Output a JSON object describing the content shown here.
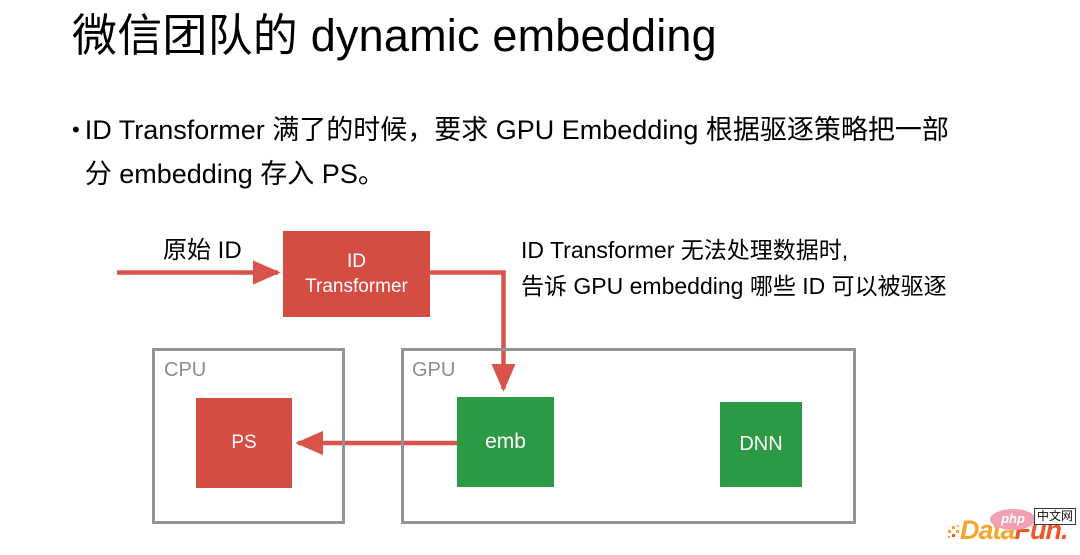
{
  "slide": {
    "title": "微信团队的 dynamic embedding",
    "bullet": {
      "marker": "•",
      "text": "ID Transformer 满了的时候，要求 GPU Embedding 根据驱逐策略把一部分 embedding 存入 PS。"
    }
  },
  "diagram": {
    "input_label": "原始 ID",
    "annotation_line1": "ID Transformer 无法处理数据时,",
    "annotation_line2": "告诉 GPU embedding 哪些 ID 可以被驱逐",
    "boxes": {
      "id_transformer_line1": "ID",
      "id_transformer_line2": "Transformer",
      "ps": "PS",
      "emb": "emb",
      "dnn": "DNN"
    },
    "containers": {
      "cpu": "CPU",
      "gpu": "GPU"
    },
    "colors": {
      "red_box": "#d44c42",
      "green_box": "#2c9a45",
      "arrow": "#d9534a",
      "container_border": "#939393",
      "container_label": "#8c8c8c"
    }
  },
  "watermark": {
    "brand_part1": "Data",
    "brand_part2": "Fun.",
    "bubble_text": "php",
    "cn_text": "中文网",
    "color_part1": "#f7a52a",
    "color_part2": "#f0542a"
  }
}
